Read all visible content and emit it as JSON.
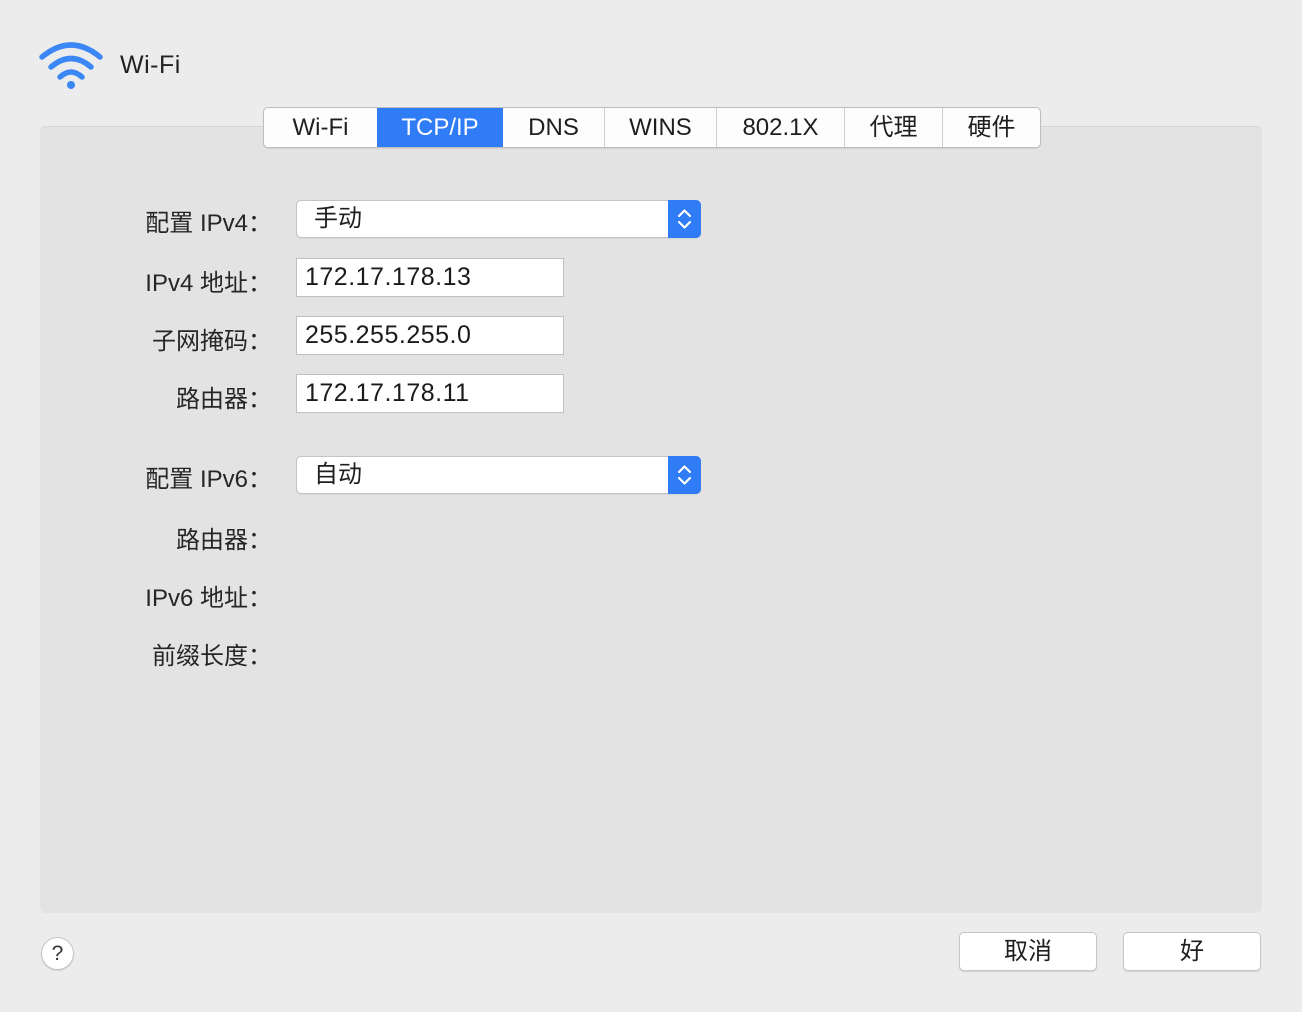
{
  "window": {
    "title": "Wi-Fi",
    "icon": "wifi-icon"
  },
  "tabs": [
    {
      "label": "Wi-Fi",
      "active": false
    },
    {
      "label": "TCP/IP",
      "active": true
    },
    {
      "label": "DNS",
      "active": false
    },
    {
      "label": "WINS",
      "active": false
    },
    {
      "label": "802.1X",
      "active": false
    },
    {
      "label": "代理",
      "active": false
    },
    {
      "label": "硬件",
      "active": false
    }
  ],
  "ipv4": {
    "configure_label": "配置 IPv4：",
    "configure_value": "手动",
    "address_label": "IPv4 地址：",
    "address_value": "172.17.178.13",
    "subnet_label": "子网掩码：",
    "subnet_value": "255.255.255.0",
    "router_label": "路由器：",
    "router_value": "172.17.178.11"
  },
  "ipv6": {
    "configure_label": "配置 IPv6：",
    "configure_value": "自动",
    "router_label": "路由器：",
    "address_label": "IPv6 地址：",
    "prefix_label": "前缀长度："
  },
  "footer": {
    "help_label": "?",
    "cancel_label": "取消",
    "ok_label": "好"
  },
  "colors": {
    "accent": "#2f7cf6",
    "window_bg": "#ececec",
    "panel_bg": "#e3e3e3"
  }
}
